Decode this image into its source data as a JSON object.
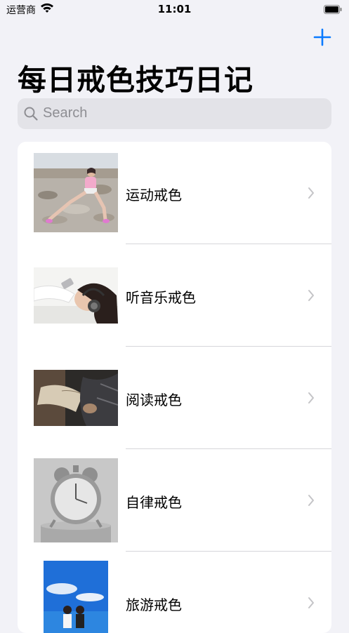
{
  "status_bar": {
    "carrier": "运营商",
    "time": "11:01"
  },
  "header": {
    "title": "每日戒色技巧日记",
    "add_icon": "plus-icon"
  },
  "search": {
    "placeholder": "Search",
    "icon": "search-icon"
  },
  "list": {
    "items": [
      {
        "label": "运动戒色"
      },
      {
        "label": "听音乐戒色"
      },
      {
        "label": "阅读戒色"
      },
      {
        "label": "自律戒色"
      },
      {
        "label": "旅游戒色"
      }
    ]
  },
  "colors": {
    "accent": "#0a7aff",
    "background": "#f2f2f7",
    "search_bg": "#e3e3e8",
    "chevron": "#c4c4c7"
  }
}
